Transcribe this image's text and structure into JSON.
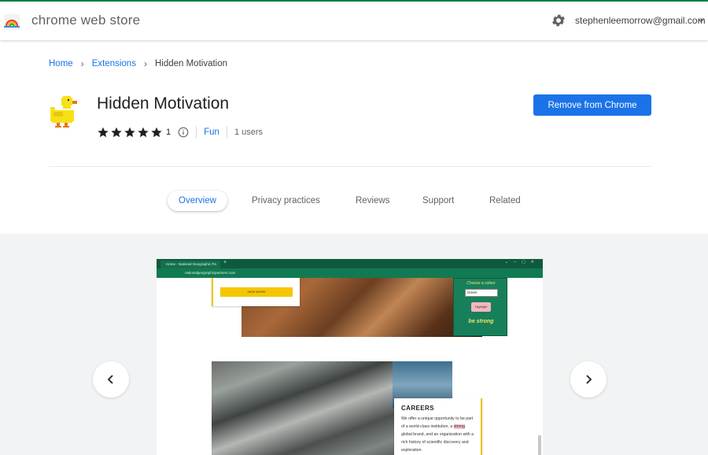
{
  "header": {
    "store_title": "chrome web store",
    "account_email": "stephenleemorrow@gmail.com",
    "settings_icon": "gear-icon",
    "logo_icon": "chrome-web-store-logo"
  },
  "breadcrumb": {
    "home": "Home",
    "extensions": "Extensions",
    "current": "Hidden Motivation",
    "separator": "›"
  },
  "extension": {
    "name": "Hidden Motivation",
    "rating_stars": 5,
    "rating_count": "1",
    "category": "Fun",
    "users": "1 users",
    "action_button": "Remove from Chrome",
    "accent_color": "#1a73e8"
  },
  "tabs": [
    {
      "label": "Overview",
      "active": true
    },
    {
      "label": "Privacy practices",
      "active": false
    },
    {
      "label": "Reviews",
      "active": false
    },
    {
      "label": "Support",
      "active": false
    },
    {
      "label": "Related",
      "active": false
    }
  ],
  "gallery": {
    "prev_icon": "chevron-left-icon",
    "next_icon": "chevron-right-icon",
    "screenshot": {
      "tab_title": "Home - National Geographic Pa",
      "url": "nationalgeographicpartners.com",
      "card1_button": "VIEW MORE",
      "popup_title": "Choose a colour",
      "popup_select": "Green",
      "popup_highlight": "Highlight",
      "popup_motto": "be strong",
      "card2_title": "CAREERS",
      "card2_text_before": "We offer a unique opportunity to be part of a world-class institution, a",
      "card2_highlight": "strong",
      "card2_text_after": "global brand, and an organization with a rich history of scientific discovery and exploration."
    }
  }
}
